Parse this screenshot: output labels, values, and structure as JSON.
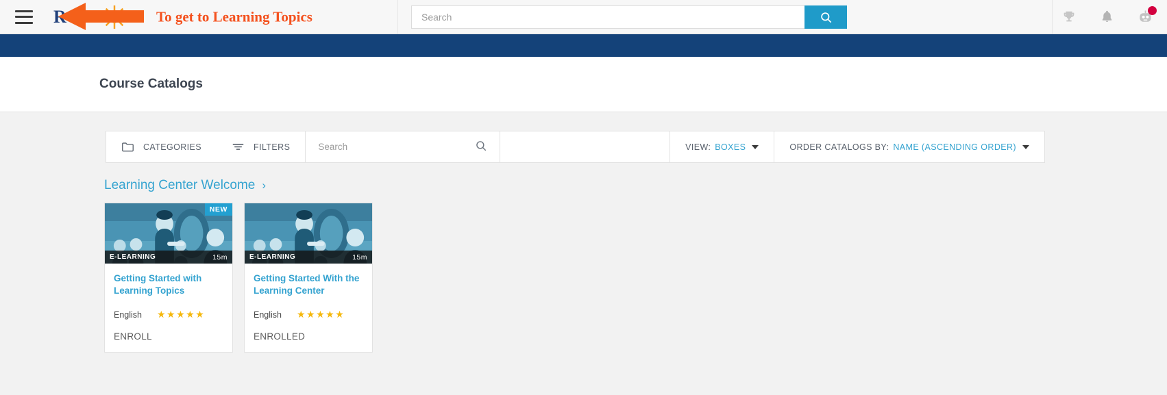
{
  "topbar": {
    "menu_icon": "hamburger-icon",
    "brand_text": "R",
    "annotation_text": "To get to Learning Topics",
    "annotation_color": "#f4511e",
    "search": {
      "placeholder": "Search",
      "value": "",
      "button_icon": "search-icon"
    },
    "icons": [
      {
        "name": "trophy-icon",
        "badge": false
      },
      {
        "name": "bell-icon",
        "badge": false
      },
      {
        "name": "assistant-robot-icon",
        "badge": true
      }
    ]
  },
  "band": {
    "color": "#144279"
  },
  "header": {
    "title": "Course Catalogs"
  },
  "toolbar": {
    "categories_label": "CATEGORIES",
    "categories_icon": "folder-icon",
    "filters_label": "FILTERS",
    "filters_icon": "filter-icon",
    "search": {
      "placeholder": "Search",
      "value": "",
      "icon": "search-icon"
    },
    "view_label": "VIEW:",
    "view_value": "BOXES",
    "order_label": "ORDER CATALOGS BY:",
    "order_value": "NAME (ASCENDING ORDER)",
    "accent_color": "#34a3d0"
  },
  "catalog": {
    "section_title": "Learning Center Welcome",
    "section_chevron": "›",
    "cards": [
      {
        "title": "Getting Started with Learning Topics",
        "type_label": "E-LEARNING",
        "duration": "15m",
        "badge": "NEW",
        "language": "English",
        "rating": 5,
        "action": "ENROLL"
      },
      {
        "title": "Getting Started With the Learning Center",
        "type_label": "E-LEARNING",
        "duration": "15m",
        "badge": "",
        "language": "English",
        "rating": 5,
        "action": "ENROLLED"
      }
    ]
  }
}
